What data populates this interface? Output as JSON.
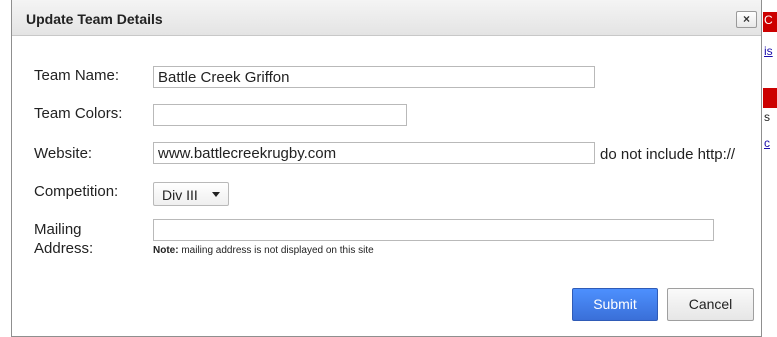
{
  "dialog": {
    "title": "Update Team Details",
    "close_label": "×"
  },
  "form": {
    "team_name": {
      "label": "Team Name:",
      "value": "Battle Creek Griffon"
    },
    "team_colors": {
      "label": "Team Colors:",
      "value": ""
    },
    "website": {
      "label": "Website:",
      "value": "www.battlecreekrugby.com",
      "hint": "do not include http://"
    },
    "competition": {
      "label": "Competition:",
      "selected": "Div III"
    },
    "mailing_address": {
      "label_line1": "Mailing",
      "label_line2": "Address:",
      "value": "",
      "note_bold": "Note:",
      "note_text": " mailing address is not displayed on this site"
    }
  },
  "buttons": {
    "submit": "Submit",
    "cancel": "Cancel"
  },
  "background_page": {
    "fragments": [
      "C",
      "is",
      "s",
      "c"
    ]
  },
  "colors": {
    "submit_bg": "#3a6fd8",
    "background_red": "#cc0000"
  }
}
